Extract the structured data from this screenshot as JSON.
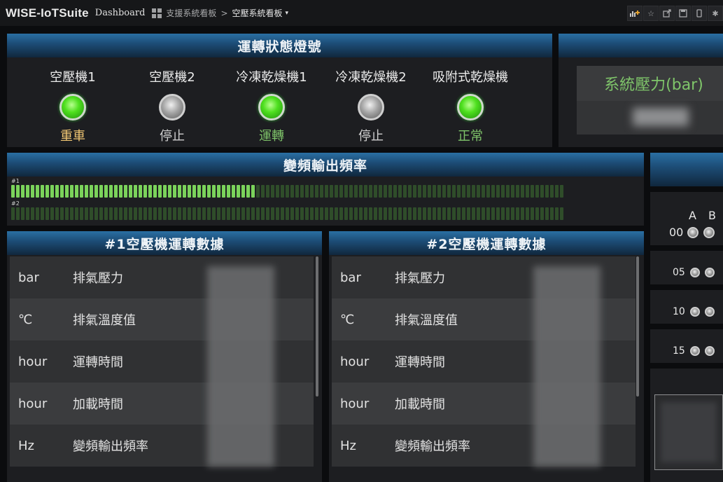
{
  "topbar": {
    "brand": "WISE-IoTSuite",
    "brand_sub": "Dashboard",
    "crumb1": "支援系統看板",
    "crumb_sep": ">",
    "crumb2": "空壓系統看板",
    "caret": "▾",
    "buttons": [
      "add-panel-icon",
      "star-icon",
      "share-icon",
      "save-icon",
      "mobile-icon",
      "settings-icon"
    ]
  },
  "status_panel": {
    "title": "運轉狀態燈號",
    "lights": [
      {
        "name": "空壓機1",
        "state": "重車",
        "lamp": "green",
        "state_color": "#f0c673"
      },
      {
        "name": "空壓機2",
        "state": "停止",
        "lamp": "gray",
        "state_color": "#cfcfcf"
      },
      {
        "name": "冷凍乾燥機1",
        "state": "運轉",
        "lamp": "green",
        "state_color": "#7fc56a"
      },
      {
        "name": "冷凍乾燥機2",
        "state": "停止",
        "lamp": "gray",
        "state_color": "#cfcfcf"
      },
      {
        "name": "吸附式乾燥機",
        "state": "正常",
        "lamp": "green",
        "state_color": "#7fc56a"
      }
    ]
  },
  "pressure_panel": {
    "title": "系統壓力(bar)"
  },
  "freq_panel": {
    "title": "變頻輸出頻率",
    "bars": [
      {
        "label": "#1",
        "fraction": 0.44
      },
      {
        "label": "#2",
        "fraction": 0.0
      }
    ]
  },
  "compressor1": {
    "title": "#1空壓機運轉數據",
    "rows": [
      {
        "unit": "bar",
        "label": "排氣壓力"
      },
      {
        "unit": "℃",
        "label": "排氣溫度值"
      },
      {
        "unit": "hour",
        "label": "運轉時間"
      },
      {
        "unit": "hour",
        "label": "加載時間"
      },
      {
        "unit": "Hz",
        "label": "變頻輸出頻率"
      }
    ]
  },
  "compressor2": {
    "title": "#2空壓機運轉數據",
    "rows": [
      {
        "unit": "bar",
        "label": "排氣壓力"
      },
      {
        "unit": "℃",
        "label": "排氣溫度值"
      },
      {
        "unit": "hour",
        "label": "運轉時間"
      },
      {
        "unit": "hour",
        "label": "加載時間"
      },
      {
        "unit": "Hz",
        "label": "變頻輸出頻率"
      }
    ]
  },
  "right_panel": {
    "header_a": "A",
    "header_b": "B",
    "rows": [
      "00",
      "05",
      "10",
      "15"
    ]
  }
}
